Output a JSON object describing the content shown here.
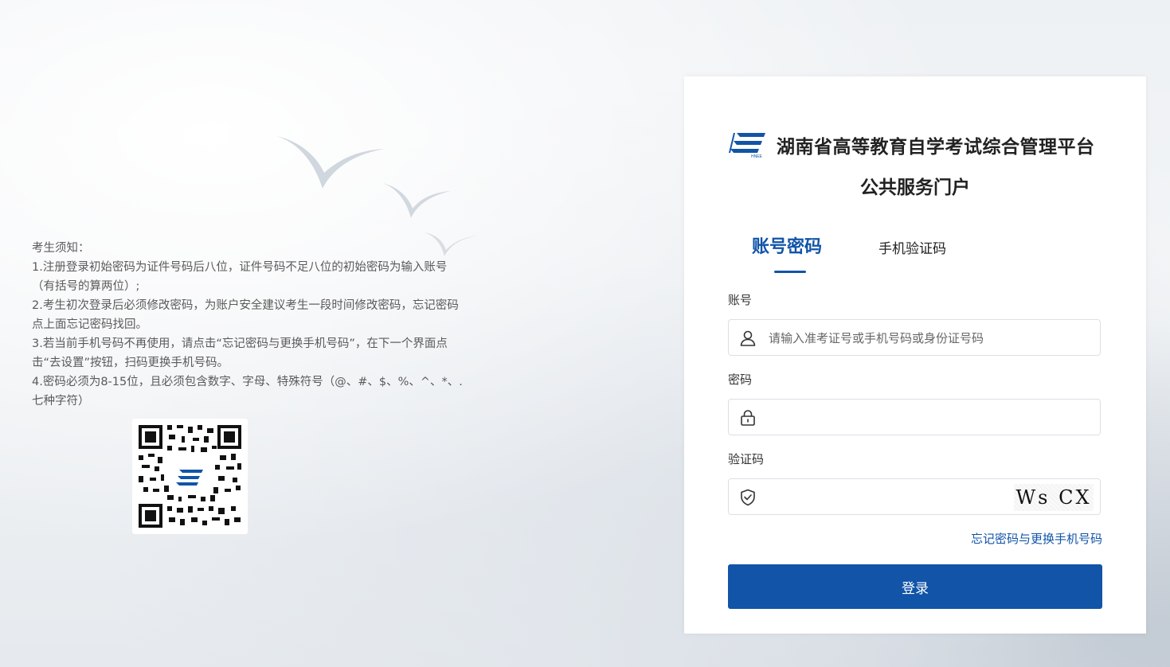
{
  "notice": {
    "heading": "考生须知：",
    "item1": "1.注册登录初始密码为证件号码后八位，证件号码不足八位的初始密码为输入账号（有括号的算两位）;",
    "item2": "2.考生初次登录后必须修改密码，为账户安全建议考生一段时间修改密码，忘记密码点上面忘记密码找回。",
    "item3": "3.若当前手机号码不再使用，请点击“忘记密码与更换手机号码”，在下一个界面点击“去设置”按钮，扫码更换手机号码。",
    "item4": "4.密码必须为8-15位，且必须包含数字、字母、特殊符号（@、#、$、%、^、*、.七种字符）"
  },
  "panel": {
    "title": "湖南省高等教育自学考试综合管理平台",
    "subtitle": "公共服务门户",
    "tabs": {
      "account": "账号密码",
      "sms": "手机验证码"
    },
    "account_label": "账号",
    "account_placeholder": "请输入准考证号或手机号码或身份证号码",
    "password_label": "密码",
    "captcha_label": "验证码",
    "captcha_text": "Ws CX",
    "forgot": "忘记密码与更换手机号码",
    "login": "登录"
  },
  "colors": {
    "brand": "#1154a8"
  }
}
